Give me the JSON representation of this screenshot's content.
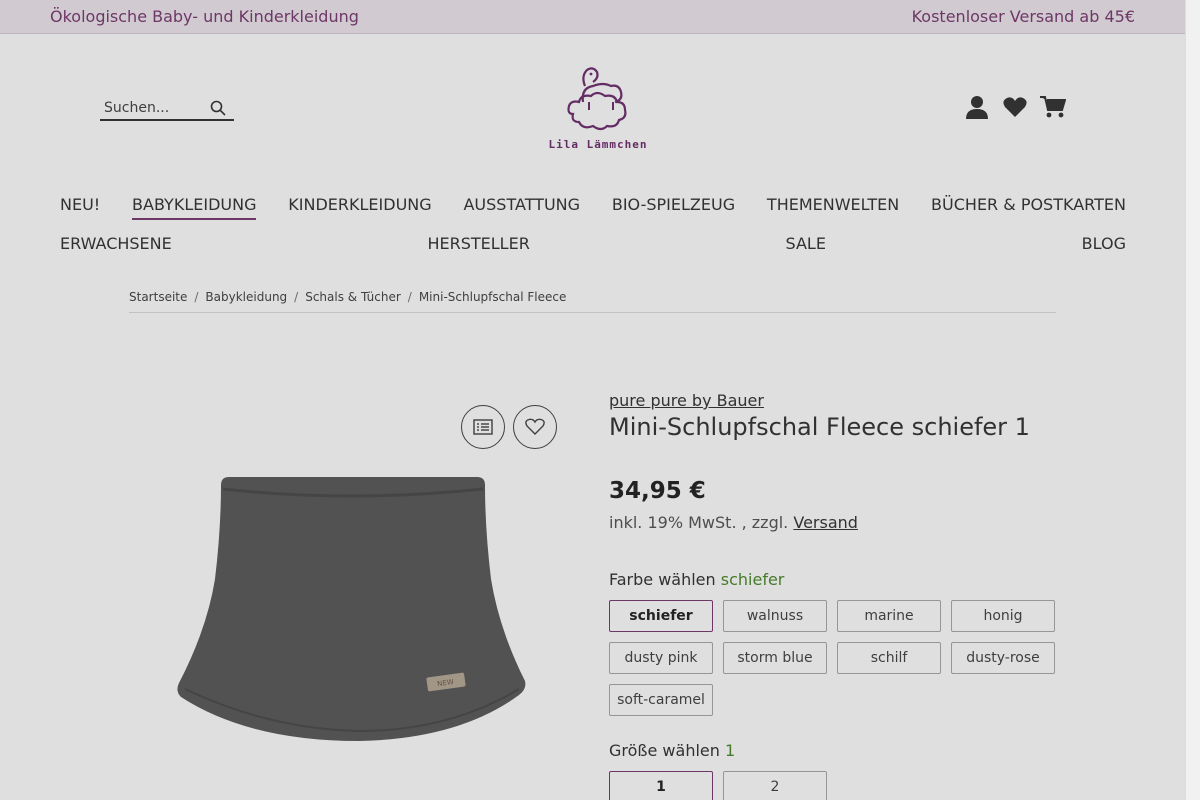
{
  "topbar": {
    "left_text": "Ökologische Baby- und Kinderkleidung",
    "right_text": "Kostenloser Versand ab 45€"
  },
  "search": {
    "placeholder": "Suchen..."
  },
  "logo": {
    "text": "Lila Lämmchen"
  },
  "header_icons": [
    "user-icon",
    "heart-icon",
    "cart-icon"
  ],
  "nav": {
    "row1": [
      "NEU!",
      "BABYKLEIDUNG",
      "KINDERKLEIDUNG",
      "AUSSTATTUNG",
      "BIO-SPIELZEUG",
      "THEMENWELTEN",
      "BÜCHER & POSTKARTEN"
    ],
    "row2": [
      "ERWACHSENE",
      "HERSTELLER",
      "SALE",
      "BLOG"
    ],
    "active": "BABYKLEIDUNG"
  },
  "breadcrumb": [
    "Startseite",
    "Babykleidung",
    "Schals & Tücher",
    "Mini-Schlupfschal Fleece"
  ],
  "product": {
    "manufacturer": "pure pure by Bauer",
    "title": "Mini-Schlupfschal Fleece schiefer 1",
    "price": "34,95 €",
    "tax_prefix": "inkl. 19% MwSt. , zzgl.",
    "shipping_link": "Versand",
    "color_label": "Farbe wählen",
    "color_selected": "schiefer",
    "colors": [
      "schiefer",
      "walnuss",
      "marine",
      "honig",
      "dusty pink",
      "storm blue",
      "schilf",
      "dusty-rose",
      "soft-caramel"
    ],
    "size_label": "Größe wählen",
    "size_selected": "1",
    "sizes": [
      "1",
      "2"
    ]
  },
  "colors": {
    "accent": "#7a3a72",
    "selected_text": "#4a8a2a",
    "topbar_bg": "#efe7ee"
  }
}
